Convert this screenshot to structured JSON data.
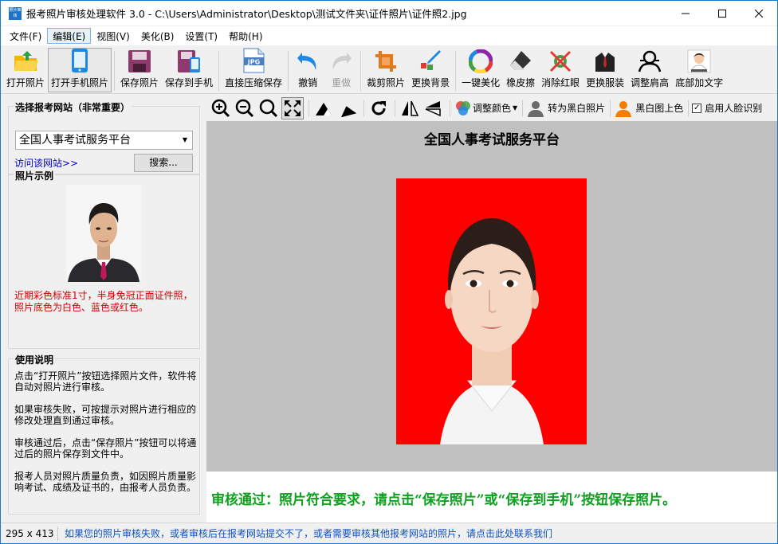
{
  "window": {
    "title": "报考照片审核处理软件 3.0 - C:\\Users\\Administrator\\Desktop\\测试文件夹\\证件照片\\证件照2.jpg",
    "app_icon_text": "照片审核"
  },
  "menu": [
    "文件(F)",
    "编辑(E)",
    "视图(V)",
    "美化(B)",
    "设置(T)",
    "帮助(H)"
  ],
  "toolbar": {
    "open_photo": "打开照片",
    "open_phone": "打开手机照片",
    "save_photo": "保存照片",
    "save_phone": "保存到手机",
    "compress_save": "直接压缩保存",
    "undo": "撤销",
    "redo": "重做",
    "crop": "裁剪照片",
    "bg": "更换背景",
    "beautify": "一键美化",
    "eraser": "橡皮擦",
    "redeye": "消除红眼",
    "clothes": "更换服装",
    "shoulder": "调整肩高",
    "bottom_text": "底部加文字"
  },
  "left": {
    "site_group_title": "选择报考网站（非常重要）",
    "site_selected": "全国人事考试服务平台",
    "visit_link": "访问该网站>>",
    "search_button": "搜索...",
    "sample_group_title": "照片示例",
    "sample_note": "近期彩色标准1寸，半身免冠正面证件照，照片底色为白色、蓝色或红色。",
    "usage_group_title": "使用说明",
    "usage": [
      "点击“打开照片”按钮选择照片文件，软件将自动对照片进行审核。",
      "如果审核失败，可按提示对照片进行相应的修改处理直到通过审核。",
      "审核通过后，点击“保存照片”按钮可以将通过后的照片保存到文件中。",
      "报考人员对照片质量负责，如因照片质量影响考试、成绩及证书的，由报考人员负责。"
    ]
  },
  "imgtoolbar": {
    "adjust_color": "调整颜色",
    "to_bw": "转为黑白照片",
    "bw_color": "黑白图上色",
    "face_detect": "启用人脸识别"
  },
  "view": {
    "site_title": "全国人事考试服务平台",
    "result": "审核通过：照片符合要求，请点击“保存照片”或“保存到手机”按钮保存照片。"
  },
  "status": {
    "size": "295 x 413",
    "message": "如果您的照片审核失败，或者审核后在报考网站提交不了，或者需要审核其他报考网站的照片，请点击此处联系我们"
  }
}
